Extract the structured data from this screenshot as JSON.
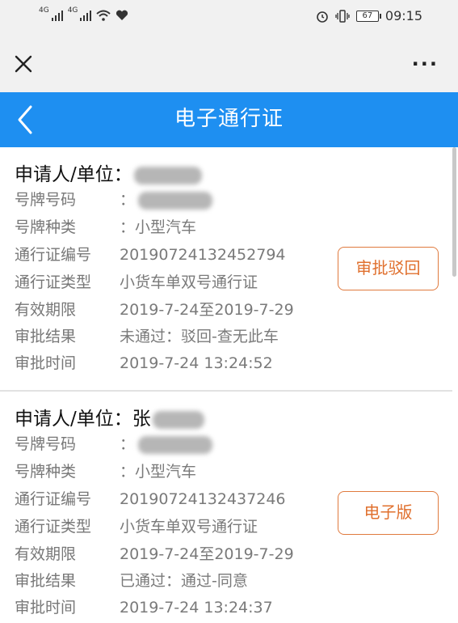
{
  "status_bar": {
    "network_1": "4G",
    "network_2": "4G",
    "battery": "67",
    "time": "09:15",
    "icons": [
      "signal-icon",
      "wifi-icon",
      "heart-icon",
      "alarm-icon",
      "vibrate-icon",
      "battery-icon"
    ]
  },
  "toolbar": {
    "close_icon": "close-icon",
    "more_label": "···"
  },
  "header": {
    "title": "电子通行证",
    "back_icon": "chevron-left-icon",
    "bg_color": "#1e8ff1"
  },
  "records": [
    {
      "applicant_label": "申请人/单位：",
      "applicant_value": "",
      "fields": [
        {
          "key": "号牌号码",
          "value": ""
        },
        {
          "key": "号牌种类",
          "value": "小型汽车"
        },
        {
          "key": "通行证编号",
          "value": "20190724132452794"
        },
        {
          "key": "通行证类型",
          "value": "小货车单双号通行证"
        },
        {
          "key": "有效期限",
          "value": "2019-7-24至2019-7-29"
        },
        {
          "key": "审批结果",
          "value": "未通过：驳回-查无此车"
        },
        {
          "key": "审批时间",
          "value": "2019-7-24 13:24:52"
        }
      ],
      "action_label": "审批驳回"
    },
    {
      "applicant_label": "申请人/单位：",
      "applicant_value": "张",
      "fields": [
        {
          "key": "号牌号码",
          "value": ""
        },
        {
          "key": "号牌种类",
          "value": "小型汽车"
        },
        {
          "key": "通行证编号",
          "value": "20190724132437246"
        },
        {
          "key": "通行证类型",
          "value": "小货车单双号通行证"
        },
        {
          "key": "有效期限",
          "value": "2019-7-24至2019-7-29"
        },
        {
          "key": "审批结果",
          "value": "已通过：通过-同意"
        },
        {
          "key": "审批时间",
          "value": "2019-7-24 13:24:37"
        }
      ],
      "action_label": "电子版"
    }
  ],
  "colors": {
    "accent_orange": "#e0702e",
    "label_gray": "#777777"
  }
}
